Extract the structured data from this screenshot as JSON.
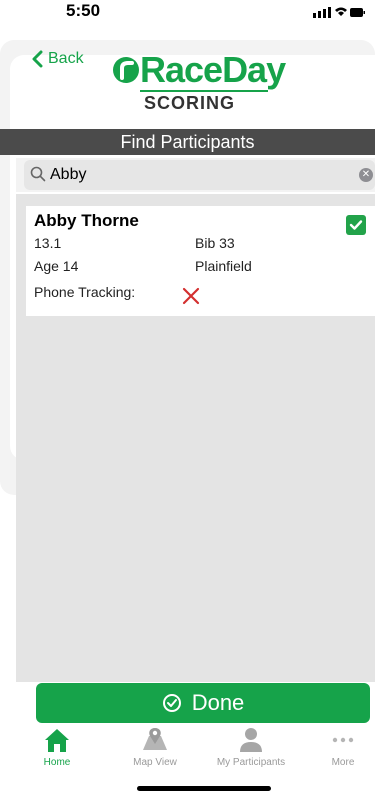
{
  "status_bar": {
    "time": "5:50"
  },
  "header": {
    "back_label": "Back",
    "logo_word": "RaceDay",
    "logo_sub": "SCORING",
    "title": "Find Participants"
  },
  "search": {
    "value": "Abby",
    "placeholder": ""
  },
  "participant": {
    "name": "Abby Thorne",
    "distance": "13.1",
    "bib": "Bib 33",
    "age": "Age 14",
    "city": "Plainfield",
    "phone_tracking_label": "Phone Tracking:",
    "selected": true,
    "phone_tracking": false
  },
  "done_label": "Done",
  "tabs": [
    {
      "label": "Home",
      "icon": "home-icon",
      "active": true
    },
    {
      "label": "Map View",
      "icon": "map-icon",
      "active": false
    },
    {
      "label": "My Participants",
      "icon": "person-icon",
      "active": false
    },
    {
      "label": "More",
      "icon": "more-icon",
      "active": false
    }
  ],
  "colors": {
    "accent": "#16a34a",
    "titlebar": "#4b4b4b",
    "error": "#d32f2f"
  }
}
